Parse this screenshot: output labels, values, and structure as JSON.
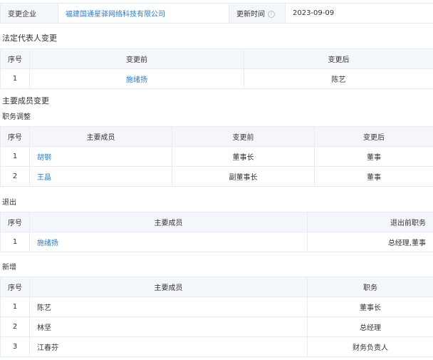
{
  "info": {
    "company_label": "变更企业",
    "company_name": "福建国通星驿网络科技有限公司",
    "time_label": "更新时间",
    "time_value": "2023-09-09"
  },
  "legal_rep": {
    "title": "法定代表人变更",
    "headers": [
      "序号",
      "变更前",
      "变更后"
    ],
    "rows": [
      {
        "idx": "1",
        "before": "施绪扬",
        "after": "陈艺"
      }
    ]
  },
  "members": {
    "title": "主要成员变更",
    "adjust": {
      "title": "职务调整",
      "headers": [
        "序号",
        "主要成员",
        "变更前",
        "变更后"
      ],
      "rows": [
        {
          "idx": "1",
          "name": "胡钢",
          "before": "董事长",
          "after": "董事"
        },
        {
          "idx": "2",
          "name": "王晶",
          "before": "副董事长",
          "after": "董事"
        }
      ]
    },
    "exit": {
      "title": "退出",
      "headers": [
        "序号",
        "主要成员",
        "退出前职务"
      ],
      "rows": [
        {
          "idx": "1",
          "name": "施绪扬",
          "role": "总经理,董事"
        }
      ]
    },
    "added": {
      "title": "新增",
      "headers": [
        "序号",
        "主要成员",
        "职务"
      ],
      "rows": [
        {
          "idx": "1",
          "name": "陈艺",
          "role": "董事长"
        },
        {
          "idx": "2",
          "name": "林坚",
          "role": "总经理"
        },
        {
          "idx": "3",
          "name": "江春芬",
          "role": "财务负责人"
        }
      ]
    }
  }
}
